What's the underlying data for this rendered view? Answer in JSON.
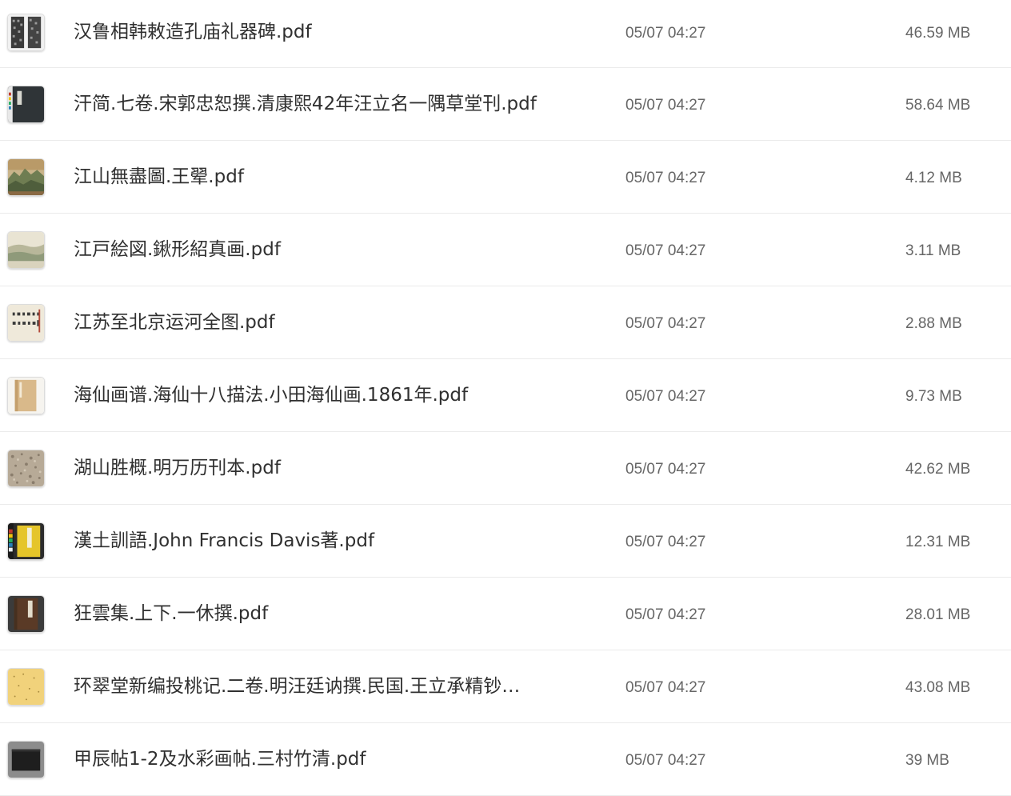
{
  "files": [
    {
      "name": "汉鲁相韩敕造孔庙礼器碑.pdf",
      "modified": "05/07 04:27",
      "size": "46.59 MB",
      "thumb": "stele-rubbing-thumbnail"
    },
    {
      "name": "汗简.七卷.宋郭忠恕撰.清康熙42年汪立名一隅草堂刊.pdf",
      "modified": "05/07 04:27",
      "size": "58.64 MB",
      "thumb": "dark-book-cover-thumbnail"
    },
    {
      "name": "江山無盡圖.王翚.pdf",
      "modified": "05/07 04:27",
      "size": "4.12 MB",
      "thumb": "landscape-scroll-thumbnail"
    },
    {
      "name": "江戸絵図.鍬形紹真画.pdf",
      "modified": "05/07 04:27",
      "size": "3.11 MB",
      "thumb": "panoramic-map-thumbnail"
    },
    {
      "name": "江苏至北京运河全图.pdf",
      "modified": "05/07 04:27",
      "size": "2.88 MB",
      "thumb": "calligraphy-title-thumbnail"
    },
    {
      "name": "海仙画谱.海仙十八描法.小田海仙画.1861年.pdf",
      "modified": "05/07 04:27",
      "size": "9.73 MB",
      "thumb": "tan-book-cover-thumbnail"
    },
    {
      "name": "湖山胜概.明万历刊本.pdf",
      "modified": "05/07 04:27",
      "size": "42.62 MB",
      "thumb": "speckled-paper-thumbnail"
    },
    {
      "name": "漢土訓語.John Francis Davis著.pdf",
      "modified": "05/07 04:27",
      "size": "12.31 MB",
      "thumb": "yellow-cover-colorbar-thumbnail"
    },
    {
      "name": "狂雲集.上下.一休撰.pdf",
      "modified": "05/07 04:27",
      "size": "28.01 MB",
      "thumb": "brown-book-thumbnail"
    },
    {
      "name": "环翠堂新编投桃记.二卷.明汪廷讷撰.民国.王立承精钞…",
      "modified": "05/07 04:27",
      "size": "43.08 MB",
      "thumb": "gold-speckled-paper-thumbnail"
    },
    {
      "name": "甲辰帖1-2及水彩画帖.三村竹清.pdf",
      "modified": "05/07 04:27",
      "size": "39 MB",
      "thumb": "black-album-thumbnail"
    }
  ]
}
